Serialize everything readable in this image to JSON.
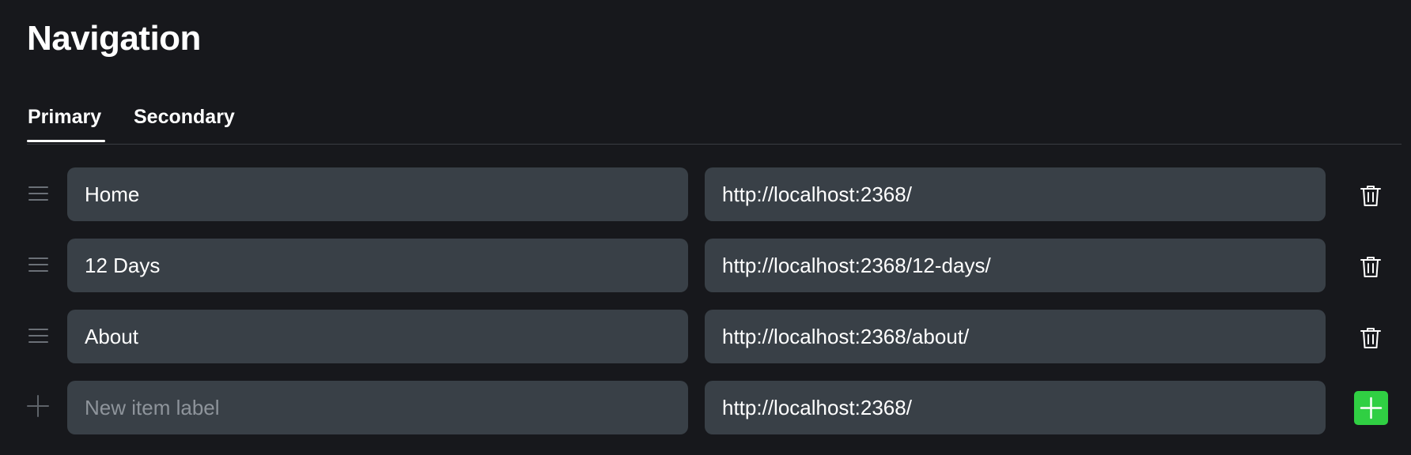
{
  "page": {
    "title": "Navigation"
  },
  "tabs": [
    {
      "label": "Primary",
      "active": true
    },
    {
      "label": "Secondary",
      "active": false
    }
  ],
  "items": [
    {
      "label": "Home",
      "url": "http://localhost:2368/"
    },
    {
      "label": "12 Days",
      "url": "http://localhost:2368/12-days/"
    },
    {
      "label": "About",
      "url": "http://localhost:2368/about/"
    }
  ],
  "new_item": {
    "label_placeholder": "New item label",
    "label_value": "",
    "url_value": "http://localhost:2368/"
  },
  "colors": {
    "background": "#17181c",
    "field": "#394047",
    "accent_green": "#30cf43"
  },
  "icons": {
    "drag": "drag-handle-icon",
    "delete": "trash-icon",
    "add": "plus-icon"
  }
}
